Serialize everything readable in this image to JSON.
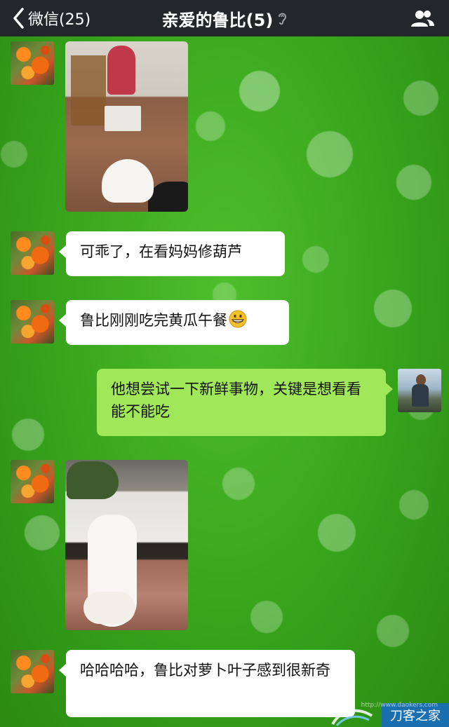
{
  "header": {
    "back_label": "微信(25)",
    "title": "亲爱的鲁比(5)",
    "icons": {
      "back": "chevron-left-icon",
      "voice_mode": "ear-icon",
      "group": "group-members-icon"
    }
  },
  "messages": [
    {
      "side": "left",
      "type": "image",
      "sender": "friend",
      "image": "woman-sewing-with-white-poodle-photo"
    },
    {
      "side": "left",
      "type": "text",
      "sender": "friend",
      "text": "可乖了，在看妈妈修葫芦"
    },
    {
      "side": "left",
      "type": "text",
      "sender": "friend",
      "text": "鲁比刚刚吃完黄瓜午餐",
      "emoji": "grinning-face-icon"
    },
    {
      "side": "right",
      "type": "text",
      "sender": "me",
      "text": "他想尝试一下新鲜事物，关键是想看看能不能吃"
    },
    {
      "side": "left",
      "type": "image",
      "sender": "friend",
      "image": "poodle-sniffing-radish-leaves-photo"
    },
    {
      "side": "left",
      "type": "text",
      "sender": "friend",
      "text": "哈哈哈哈，鲁比对萝卜叶子感到很新奇"
    }
  ],
  "watermark": {
    "url": "http://www.daokers.com",
    "label": "刀客之家"
  },
  "colors": {
    "header_bg": "#23262b",
    "bubble_left": "#ffffff",
    "bubble_right": "#a0e75a",
    "chat_bg": "#3aa51e"
  }
}
